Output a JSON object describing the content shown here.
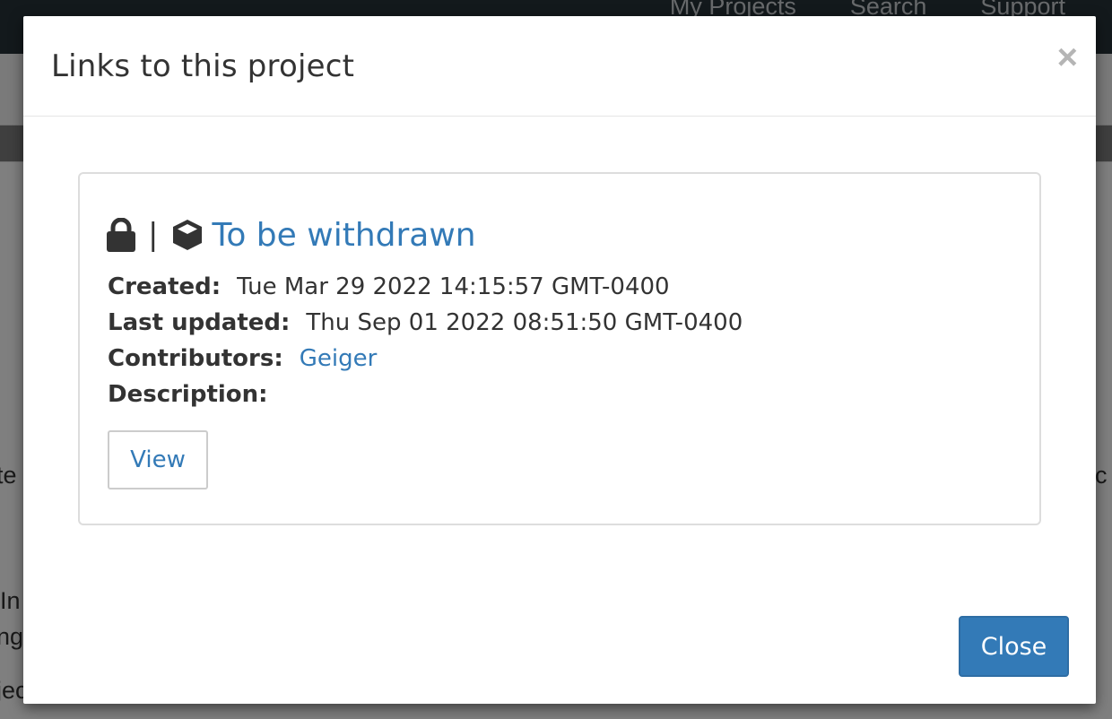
{
  "background": {
    "nav_links": [
      "My Projects",
      "Search",
      "Support"
    ],
    "fragments": {
      "left_1": "te",
      "right_1": "ec",
      "left_2": "In",
      "left_3": "ng",
      "left_4": "jec"
    }
  },
  "modal": {
    "title": "Links to this project",
    "close_symbol": "×",
    "card": {
      "separator": "|",
      "project_title": "To be withdrawn",
      "lock_icon": "lock-icon",
      "cube_icon": "cube-icon",
      "meta": {
        "created_label": "Created:",
        "created_value": "Tue Mar 29 2022 14:15:57 GMT-0400",
        "updated_label": "Last updated:",
        "updated_value": "Thu Sep 01 2022 08:51:50 GMT-0400",
        "contributors_label": "Contributors:",
        "contributors_value": "Geiger",
        "description_label": "Description:",
        "description_value": ""
      },
      "view_label": "View"
    },
    "close_label": "Close"
  },
  "colors": {
    "link": "#337ab7",
    "primary_button": "#337ab7",
    "navbar": "#263238"
  }
}
